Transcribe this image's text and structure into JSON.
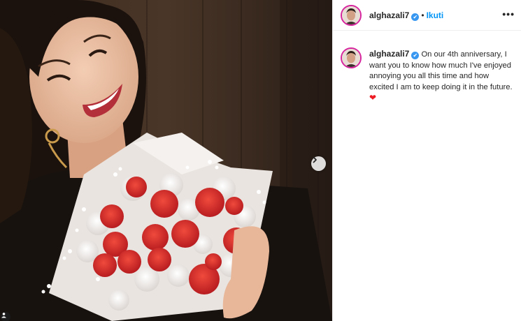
{
  "post": {
    "username": "alghazali7",
    "verified_symbol": "✔",
    "separator": "•",
    "follow_label": "Ikuti",
    "more_icon": "more-horizontal-icon",
    "more_symbol": "•••"
  },
  "caption": {
    "username": "alghazali7",
    "text": "On our 4th anniversary, I want you to know how much I've enjoyed annoying you all this time and how excited I am to keep doing it in the future.",
    "emoji": "❤"
  },
  "media": {
    "next_icon": "chevron-right-icon",
    "tag_icon": "user-tag-icon"
  },
  "colors": {
    "follow_blue": "#0095f6",
    "verified_blue": "#3897f0",
    "heart_red": "#ed1c24",
    "rose_red": "#d8262a"
  }
}
